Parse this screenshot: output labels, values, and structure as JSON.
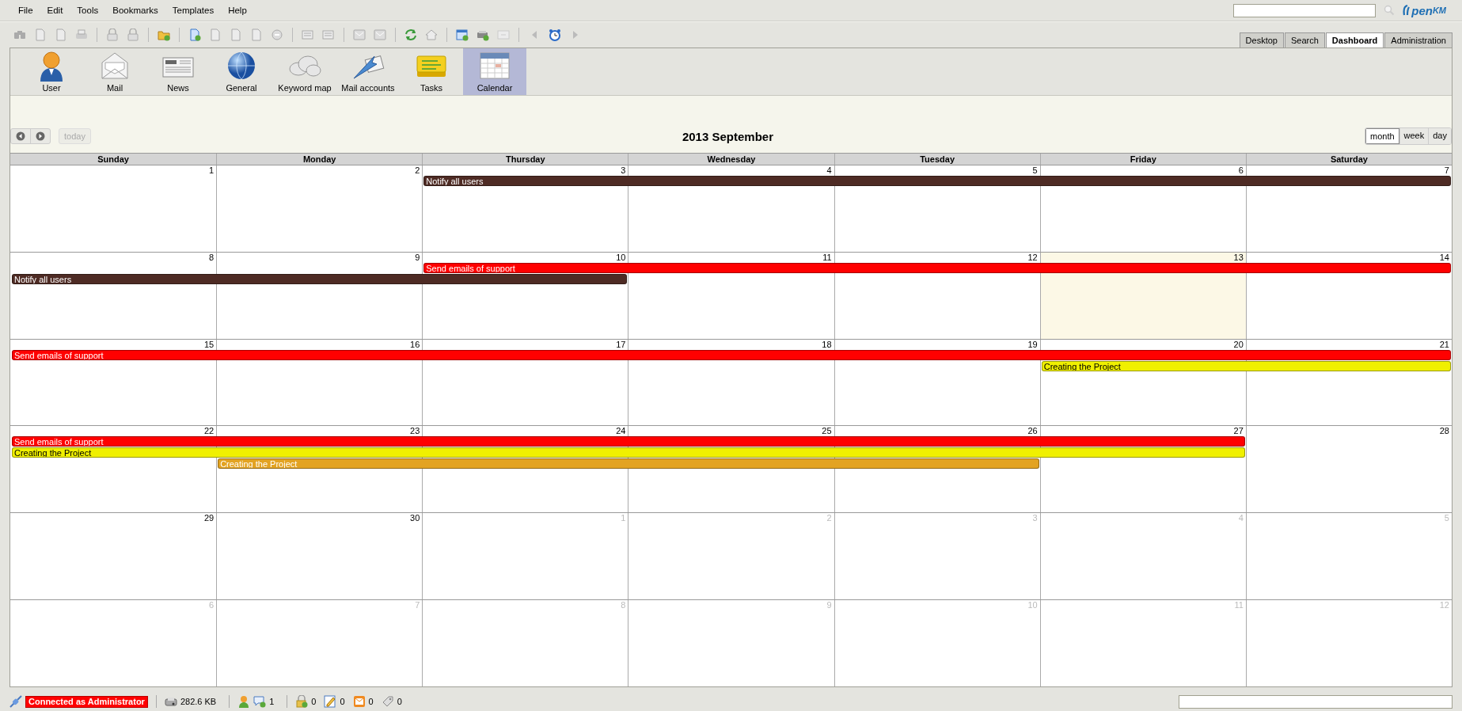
{
  "menu": [
    {
      "label": "File"
    },
    {
      "label": "Edit"
    },
    {
      "label": "Tools"
    },
    {
      "label": "Bookmarks"
    },
    {
      "label": "Templates"
    },
    {
      "label": "Help"
    }
  ],
  "logo": {
    "main": "pen",
    "suffix": "KM"
  },
  "toolbar_groups": [
    [
      {
        "disabled": true
      },
      {
        "disabled": true
      },
      {
        "disabled": true
      },
      {
        "disabled": true
      }
    ],
    [
      {
        "disabled": true
      },
      {
        "disabled": true
      }
    ],
    [
      {
        "disabled": false
      }
    ],
    [
      {
        "disabled": false
      },
      {
        "disabled": true
      },
      {
        "disabled": true
      },
      {
        "disabled": true
      },
      {
        "disabled": true
      }
    ],
    [
      {
        "disabled": true
      },
      {
        "disabled": true
      }
    ],
    [
      {
        "disabled": true
      },
      {
        "disabled": true
      }
    ],
    [
      {
        "disabled": false
      },
      {
        "disabled": true
      }
    ],
    [
      {
        "disabled": false
      },
      {
        "disabled": false
      },
      {
        "disabled": true
      }
    ],
    [
      {
        "disabled": true
      },
      {
        "disabled": false
      },
      {
        "disabled": true
      }
    ]
  ],
  "tabs": [
    {
      "label": "Desktop",
      "selected": false
    },
    {
      "label": "Search",
      "selected": false
    },
    {
      "label": "Dashboard",
      "selected": true
    },
    {
      "label": "Administration",
      "selected": false
    }
  ],
  "dashboard_tools": [
    {
      "label": "User",
      "selected": false
    },
    {
      "label": "Mail",
      "selected": false
    },
    {
      "label": "News",
      "selected": false
    },
    {
      "label": "General",
      "selected": false
    },
    {
      "label": "Keyword map",
      "selected": false
    },
    {
      "label": "Mail accounts",
      "selected": false
    },
    {
      "label": "Tasks",
      "selected": false
    },
    {
      "label": "Calendar",
      "selected": true
    }
  ],
  "calendar": {
    "title": "2013 September",
    "today_button": {
      "label": "today",
      "disabled": true
    },
    "views": [
      {
        "label": "month",
        "selected": true
      },
      {
        "label": "week",
        "selected": false
      },
      {
        "label": "day",
        "selected": false
      }
    ],
    "weekdays": [
      "Sunday",
      "Monday",
      "Thursday",
      "Wednesday",
      "Tuesday",
      "Friday",
      "Saturday"
    ],
    "weeks": [
      {
        "days": [
          {
            "label": "1",
            "other_month": false,
            "today": false
          },
          {
            "label": "2",
            "other_month": false,
            "today": false
          },
          {
            "label": "3",
            "other_month": false,
            "today": false,
            "lanes": [
              {
                "kind": "event_start",
                "title": "Notify all users",
                "color": "#4e2b24"
              }
            ]
          },
          {
            "label": "4",
            "other_month": false,
            "today": false,
            "lanes": [
              {
                "kind": "event_continues"
              }
            ]
          },
          {
            "label": "5",
            "other_month": false,
            "today": false,
            "lanes": [
              {
                "kind": "event_continues"
              }
            ]
          },
          {
            "label": "6",
            "other_month": false,
            "today": false,
            "lanes": [
              {
                "kind": "event_continues"
              }
            ]
          },
          {
            "label": "7",
            "other_month": false,
            "today": false,
            "lanes": [
              {
                "kind": "event_continues"
              }
            ]
          }
        ]
      },
      {
        "days": [
          {
            "label": "8",
            "other_month": false,
            "today": false,
            "lanes": [
              {
                "kind": "free"
              },
              {
                "kind": "event_start",
                "title": "Notify all users",
                "color": "#4e2b24"
              }
            ]
          },
          {
            "label": "9",
            "other_month": false,
            "today": false,
            "lanes": [
              {
                "kind": "free"
              },
              {
                "kind": "event_continues"
              }
            ]
          },
          {
            "label": "10",
            "other_month": false,
            "today": false,
            "lanes": [
              {
                "kind": "event_start",
                "title": "Send emails of support",
                "color": "#ff0000"
              },
              {
                "kind": "event_continues"
              }
            ]
          },
          {
            "label": "11",
            "other_month": false,
            "today": false,
            "lanes": [
              {
                "kind": "event_continues"
              }
            ]
          },
          {
            "label": "12",
            "other_month": false,
            "today": false,
            "lanes": [
              {
                "kind": "event_continues"
              }
            ]
          },
          {
            "label": "13",
            "other_month": false,
            "today": true,
            "lanes": [
              {
                "kind": "event_continues"
              }
            ]
          },
          {
            "label": "14",
            "other_month": false,
            "today": false,
            "lanes": [
              {
                "kind": "event_continues"
              }
            ]
          }
        ]
      },
      {
        "days": [
          {
            "label": "15",
            "other_month": false,
            "today": false,
            "lanes": [
              {
                "kind": "event_start",
                "title": "Send emails of support",
                "color": "#ff0000"
              }
            ]
          },
          {
            "label": "16",
            "other_month": false,
            "today": false,
            "lanes": [
              {
                "kind": "event_continues"
              }
            ]
          },
          {
            "label": "17",
            "other_month": false,
            "today": false,
            "lanes": [
              {
                "kind": "event_continues"
              }
            ]
          },
          {
            "label": "18",
            "other_month": false,
            "today": false,
            "lanes": [
              {
                "kind": "event_continues"
              }
            ]
          },
          {
            "label": "19",
            "other_month": false,
            "today": false,
            "lanes": [
              {
                "kind": "event_continues"
              }
            ]
          },
          {
            "label": "20",
            "other_month": false,
            "today": false,
            "lanes": [
              {
                "kind": "event_continues"
              },
              {
                "kind": "event_start",
                "title": "Creating the Project",
                "color": "#f0f000"
              }
            ]
          },
          {
            "label": "21",
            "other_month": false,
            "today": false,
            "lanes": [
              {
                "kind": "event_continues"
              },
              {
                "kind": "event_continues"
              }
            ]
          }
        ]
      },
      {
        "days": [
          {
            "label": "22",
            "other_month": false,
            "today": false,
            "lanes": [
              {
                "kind": "event_start",
                "title": "Send emails of support",
                "color": "#ff0000"
              },
              {
                "kind": "event_start",
                "title": "Creating the Project",
                "color": "#f0f000"
              }
            ]
          },
          {
            "label": "23",
            "other_month": false,
            "today": false,
            "lanes": [
              {
                "kind": "event_continues"
              },
              {
                "kind": "event_continues"
              },
              {
                "kind": "event_start",
                "title": "Creating the Project",
                "color": "#e3a322"
              }
            ]
          },
          {
            "label": "24",
            "other_month": false,
            "today": false,
            "lanes": [
              {
                "kind": "event_continues"
              },
              {
                "kind": "event_continues"
              },
              {
                "kind": "event_continues"
              }
            ]
          },
          {
            "label": "25",
            "other_month": false,
            "today": false,
            "lanes": [
              {
                "kind": "event_continues"
              },
              {
                "kind": "event_continues"
              },
              {
                "kind": "event_continues"
              }
            ]
          },
          {
            "label": "26",
            "other_month": false,
            "today": false,
            "lanes": [
              {
                "kind": "event_continues"
              },
              {
                "kind": "event_continues"
              },
              {
                "kind": "event_continues"
              }
            ]
          },
          {
            "label": "27",
            "other_month": false,
            "today": false,
            "lanes": [
              {
                "kind": "event_continues"
              },
              {
                "kind": "event_continues"
              }
            ]
          },
          {
            "label": "28",
            "other_month": false,
            "today": false
          }
        ]
      },
      {
        "days": [
          {
            "label": "29",
            "other_month": false,
            "today": false
          },
          {
            "label": "30",
            "other_month": false,
            "today": false
          },
          {
            "label": "1",
            "other_month": true,
            "today": false
          },
          {
            "label": "2",
            "other_month": true,
            "today": false
          },
          {
            "label": "3",
            "other_month": true,
            "today": false
          },
          {
            "label": "4",
            "other_month": true,
            "today": false
          },
          {
            "label": "5",
            "other_month": true,
            "today": false
          }
        ]
      },
      {
        "days": [
          {
            "label": "6",
            "other_month": true,
            "today": false
          },
          {
            "label": "7",
            "other_month": true,
            "today": false
          },
          {
            "label": "8",
            "other_month": true,
            "today": false
          },
          {
            "label": "9",
            "other_month": true,
            "today": false
          },
          {
            "label": "10",
            "other_month": true,
            "today": false
          },
          {
            "label": "11",
            "other_month": true,
            "today": false
          },
          {
            "label": "12",
            "other_month": true,
            "today": false
          }
        ]
      }
    ]
  },
  "status_bar": {
    "connection": "Connected as Administrator",
    "storage": "282.6 KB",
    "counters": [
      "1",
      "0",
      "0",
      "0",
      "0"
    ]
  }
}
